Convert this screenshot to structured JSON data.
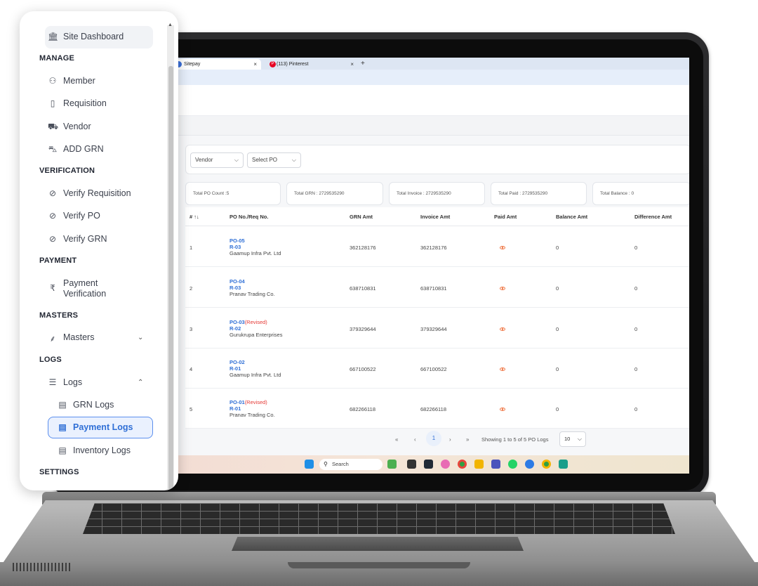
{
  "browser": {
    "tabs": [
      {
        "label": "Sitepay",
        "active": true
      },
      {
        "label": "(113) Pinterest",
        "active": false
      }
    ],
    "close_glyph": "×",
    "new_tab_glyph": "+"
  },
  "filters": {
    "vendor": "Vendor",
    "select_po": "Select PO"
  },
  "stats": {
    "po_count": "Total PO Count :5",
    "grn": "Total GRN : 2729535290",
    "invoice": "Total Invoice : 2729535290",
    "paid": "Total Paid : 2729535290",
    "balance": "Total Balance : 0"
  },
  "table": {
    "headers": [
      "# ↑↓",
      "PO No./Req No.",
      "GRN Amt",
      "Invoice Amt",
      "Paid Amt",
      "Balance Amt",
      "Difference Amt"
    ],
    "rows": [
      {
        "num": "1",
        "po": "PO-05",
        "revised": "",
        "req": "R-03",
        "vendor": "Gaamup Infra Pvt. Ltd",
        "grn": "362128176",
        "invoice": "362128176",
        "balance": "0",
        "difference": "0"
      },
      {
        "num": "2",
        "po": "PO-04",
        "revised": "",
        "req": "R-03",
        "vendor": "Pranav Trading Co.",
        "grn": "638710831",
        "invoice": "638710831",
        "balance": "0",
        "difference": "0"
      },
      {
        "num": "3",
        "po": "PO-03",
        "revised": "(Revised)",
        "req": "R-02",
        "vendor": "Gurukrupa Enterprises",
        "grn": "379329644",
        "invoice": "379329644",
        "balance": "0",
        "difference": "0"
      },
      {
        "num": "4",
        "po": "PO-02",
        "revised": "",
        "req": "R-01",
        "vendor": "Gaamup Infra Pvt. Ltd",
        "grn": "667100522",
        "invoice": "667100522",
        "balance": "0",
        "difference": "0"
      },
      {
        "num": "5",
        "po": "PO-01",
        "revised": "(Revised)",
        "req": "R-01",
        "vendor": "Pranav Trading Co.",
        "grn": "682266118",
        "invoice": "682266118",
        "balance": "0",
        "difference": "0"
      }
    ]
  },
  "pagination": {
    "first": "«",
    "prev": "‹",
    "current": "1",
    "next": "›",
    "last": "»",
    "info": "Showing 1 to 5 of 5 PO Logs",
    "per_page": "10"
  },
  "taskbar": {
    "search": "Search"
  },
  "sidebar": {
    "dashboard": "Site Dashboard",
    "sections": {
      "manage": "MANAGE",
      "verification": "VERIFICATION",
      "payment": "PAYMENT",
      "masters": "MASTERS",
      "logs": "LOGS",
      "settings": "SETTINGS"
    },
    "items": {
      "member": "Member",
      "requisition": "Requisition",
      "vendor": "Vendor",
      "add_grn": "ADD GRN",
      "verify_requisition": "Verify Requisition",
      "verify_po": "Verify PO",
      "verify_grn": "Verify GRN",
      "payment_verification_1": "Payment",
      "payment_verification_2": "Verification",
      "masters": "Masters",
      "logs": "Logs",
      "grn_logs": "GRN Logs",
      "payment_logs": "Payment Logs",
      "inventory_logs": "Inventory Logs"
    },
    "icons": {
      "dashboard": "bank-icon",
      "member": "users-icon",
      "requisition": "document-icon",
      "vendor": "cart-icon",
      "add_grn": "truck-icon",
      "verify": "check-circle-icon",
      "payment": "rupee-icon",
      "masters": "sitemap-icon",
      "logs": "database-icon",
      "log_item": "list-icon"
    },
    "active_item": "Payment Logs"
  },
  "colors": {
    "link_blue": "#2f6fd6",
    "revised_red": "#e53935",
    "eye_orange": "#f07a4a",
    "active_border": "#5b8fee"
  }
}
